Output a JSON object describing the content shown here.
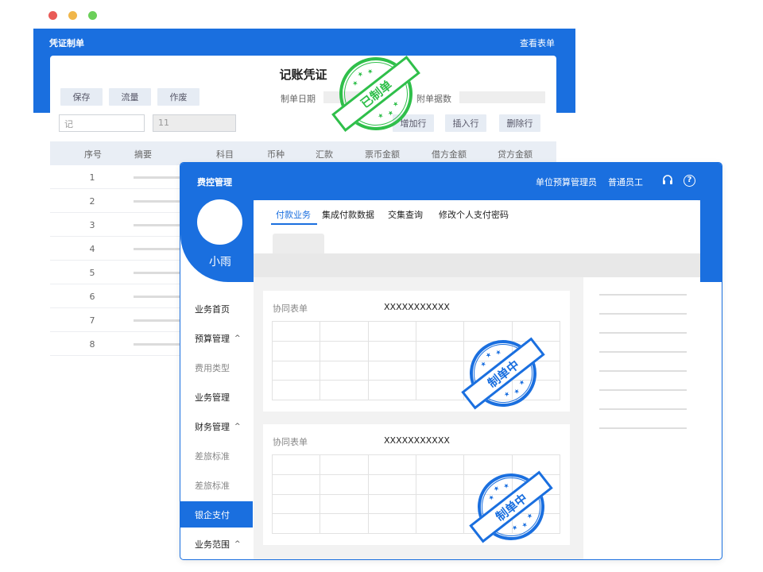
{
  "window_dots": [
    {
      "name": "close",
      "color": "#e95b57"
    },
    {
      "name": "minimize",
      "color": "#f0b64a"
    },
    {
      "name": "maximize",
      "color": "#6bcf5a"
    }
  ],
  "back_window": {
    "header_title": "凭证制单",
    "header_link": "查看表单",
    "voucher_title": "记账凭证",
    "buttons": {
      "save": "保存",
      "flow": "流量",
      "void": "作废"
    },
    "labels": {
      "date": "制单日期",
      "attach": "附单据数"
    },
    "inputs": {
      "type": "记",
      "number": "11"
    },
    "row_actions": {
      "add": "增加行",
      "insert": "插入行",
      "delete": "删除行"
    },
    "columns": [
      "序号",
      "摘要",
      "科目",
      "币种",
      "汇款",
      "票币金额",
      "借方金额",
      "贷方金额"
    ],
    "rows": [
      "1",
      "2",
      "3",
      "4",
      "5",
      "6",
      "7",
      "8"
    ],
    "stamp_text": "已制单",
    "stamp_color": "#2fbf4a"
  },
  "front_window": {
    "brand": "费控管理",
    "role_primary": "单位预算管理员",
    "role_secondary": "普通员工",
    "icons": [
      "headset-icon",
      "help-icon"
    ],
    "help_glyph": "?",
    "username": "小雨",
    "nav": [
      {
        "label": "业务首页",
        "style": "strong",
        "chevron": ""
      },
      {
        "label": "预算管理",
        "style": "strong",
        "chevron": "^"
      },
      {
        "label": "费用类型",
        "style": "sub",
        "chevron": ""
      },
      {
        "label": "业务管理",
        "style": "strong",
        "chevron": ""
      },
      {
        "label": "财务管理",
        "style": "strong",
        "chevron": "^"
      },
      {
        "label": "差旅标准",
        "style": "sub",
        "chevron": ""
      },
      {
        "label": "差旅标准",
        "style": "sub",
        "chevron": ""
      },
      {
        "label": "银企支付",
        "style": "active",
        "chevron": ""
      },
      {
        "label": "业务范围",
        "style": "strong",
        "chevron": "^"
      }
    ],
    "tabs": [
      "付款业务",
      "集成付款数据",
      "交集查询",
      "修改个人支付密码"
    ],
    "active_tab": 0,
    "cards": [
      {
        "title": "协同表单",
        "value": "XXXXXXXXXXX",
        "stamp_text": "制单中"
      },
      {
        "title": "协同表单",
        "value": "XXXXXXXXXXX",
        "stamp_text": "制单中"
      }
    ],
    "stamp_color": "#1a6fdf",
    "accent": "#1a6fdf"
  }
}
